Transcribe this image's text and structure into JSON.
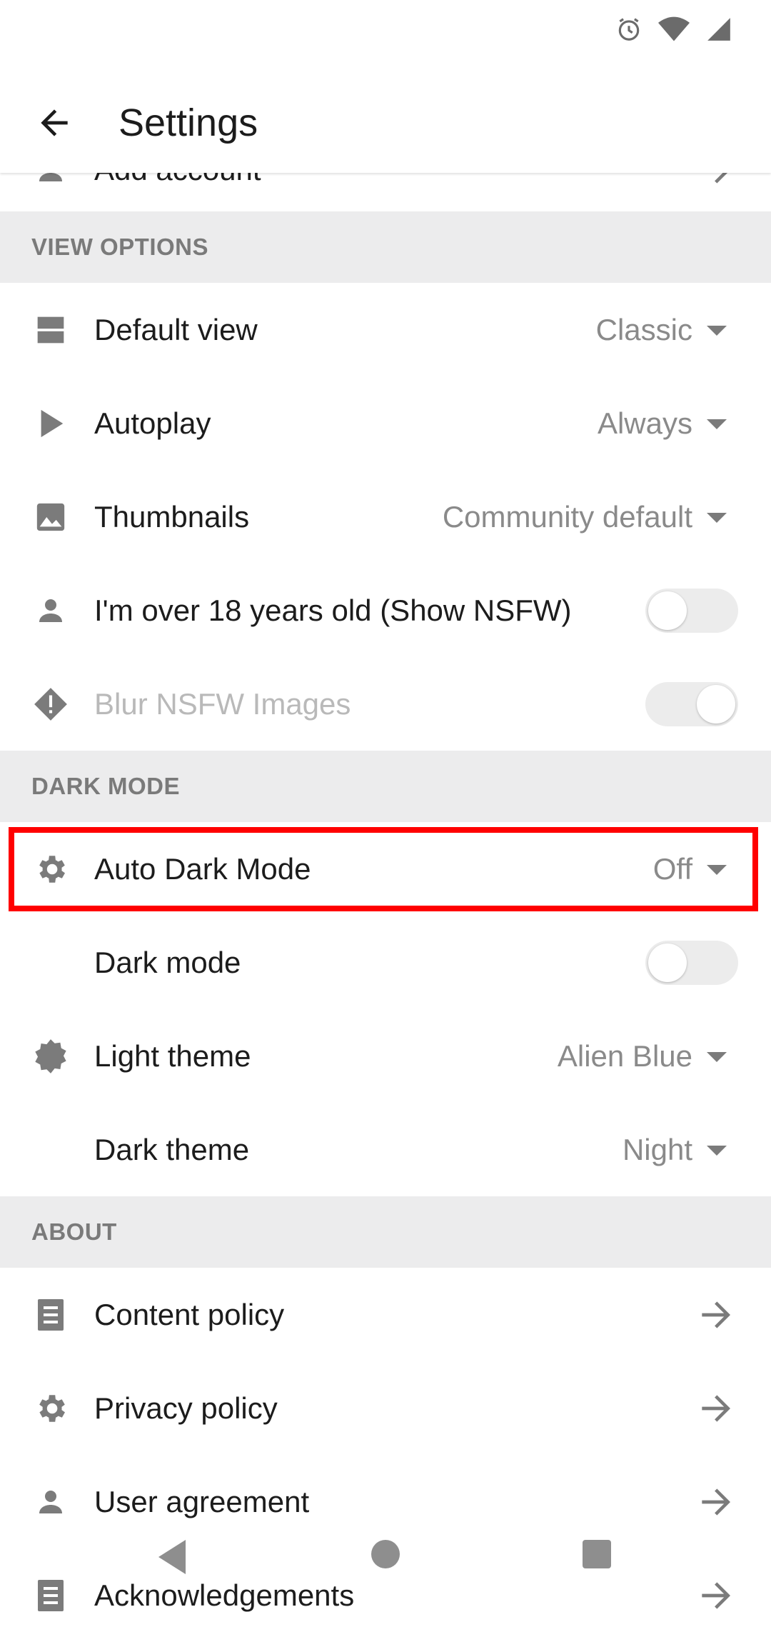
{
  "app_bar": {
    "title": "Settings"
  },
  "partial_row": {
    "label": "Add account"
  },
  "sections": {
    "view_options": {
      "header": "VIEW OPTIONS",
      "default_view": {
        "label": "Default view",
        "value": "Classic"
      },
      "autoplay": {
        "label": "Autoplay",
        "value": "Always"
      },
      "thumbnails": {
        "label": "Thumbnails",
        "value": "Community default"
      },
      "nsfw": {
        "label": "I'm over 18 years old (Show NSFW)",
        "toggle": "off"
      },
      "blur_nsfw": {
        "label": "Blur NSFW Images",
        "toggle": "on",
        "disabled": true
      }
    },
    "dark_mode": {
      "header": "DARK MODE",
      "auto_dark": {
        "label": "Auto Dark Mode",
        "value": "Off"
      },
      "dark_mode_toggle": {
        "label": "Dark mode",
        "toggle": "off"
      },
      "light_theme": {
        "label": "Light theme",
        "value": "Alien Blue"
      },
      "dark_theme": {
        "label": "Dark theme",
        "value": "Night"
      }
    },
    "about": {
      "header": "ABOUT",
      "content_policy": {
        "label": "Content policy"
      },
      "privacy_policy": {
        "label": "Privacy policy"
      },
      "user_agreement": {
        "label": "User agreement"
      },
      "acknowledgements": {
        "label": "Acknowledgements"
      }
    }
  },
  "colors": {
    "highlight": "#ff0000",
    "section_bg": "#ececed",
    "icon": "#7b7b7b"
  }
}
